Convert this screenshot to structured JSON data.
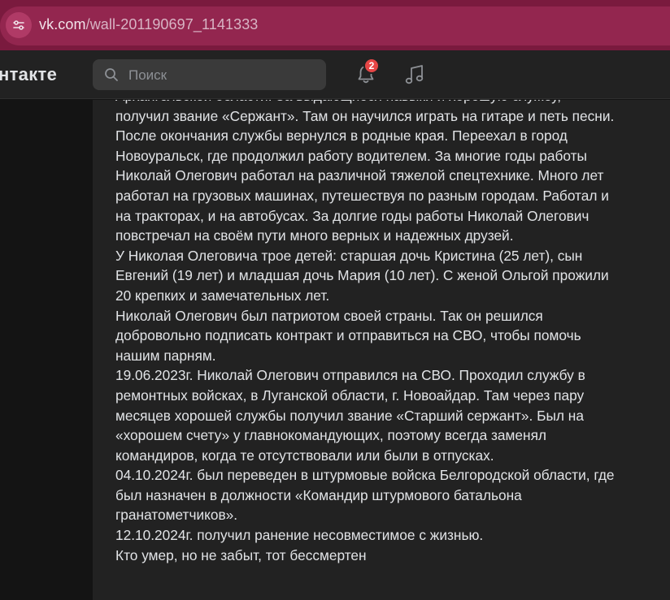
{
  "browser": {
    "url_host": "vk.com",
    "url_path": "/wall-201190697_1141333"
  },
  "header": {
    "logo_text": "нтакте",
    "search_placeholder": "Поиск",
    "notifications_count": "2",
    "icons": [
      "search-icon",
      "bell-icon",
      "music-icon",
      "site-info-icon"
    ]
  },
  "post": {
    "lines": [
      "Архангельской области. За выдающиеся навыки и хорошую службу,",
      "получил звание «Сержант». Там он научился играть на гитаре и петь песни.",
      "После окончания службы вернулся в родные края. Переехал в город",
      "Новоуральск, где продолжил работу водителем. За многие годы работы",
      "Николай Олегович работал на различной тяжелой спецтехнике. Много лет",
      "работал на грузовых машинах, путешествуя по разным городам. Работал и",
      "на тракторах, и на автобусах. За долгие годы работы Николай Олегович",
      "повстречал на своём пути много верных и надежных друзей.",
      "У Николая Олеговича трое детей: старшая дочь Кристина (25 лет), сын",
      "Евгений (19 лет) и младшая дочь Мария (10 лет). С женой Ольгой прожили",
      "20 крепких и замечательных лет.",
      "Николай Олегович был патриотом своей страны. Так он решился",
      "добровольно подписать контракт и отправиться на СВО, чтобы помочь",
      "нашим парням.",
      "19.06.2023г. Николай Олегович отправился на СВО. Проходил службу в",
      "ремонтных войсках, в Луганской области, г. Новоайдар. Там через пару",
      "месяцев хорошей службы получил звание «Старший сержант». Был на",
      "«хорошем счету» у главнокомандующих, поэтому всегда заменял",
      "командиров, когда те отсутствовали или были в отпусках.",
      "04.10.2024г. был переведен в штурмовые войска Белгородской области, где",
      "был назначен в должности «Командир штурмового батальона",
      "гранатометчиков».",
      "12.10.2024г. получил ранение несовместимое с жизнью.",
      "Кто умер, но не забыт, тот бессмертен"
    ]
  }
}
